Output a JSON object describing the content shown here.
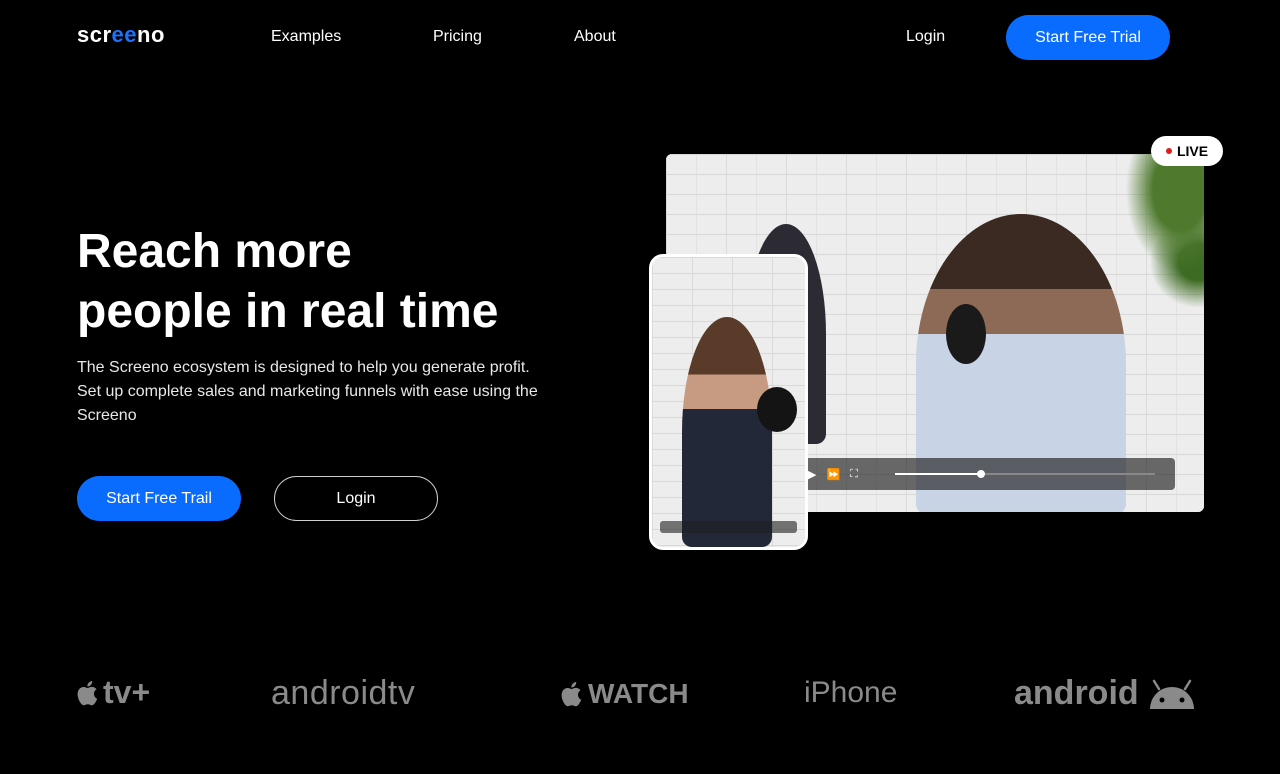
{
  "nav": {
    "logo": "screeno",
    "links": [
      "Examples",
      "Pricing",
      "About"
    ],
    "login": "Login",
    "cta": "Start Free Trial"
  },
  "hero": {
    "title_line1": "Reach more",
    "title_line2": "people in real time",
    "description": "The Screeno ecosystem is designed to help you generate profit. Set up complete sales and marketing funnels with ease using the Screeno",
    "primary_button": "Start Free Trail",
    "secondary_button": "Login"
  },
  "media": {
    "live_badge": "LIVE",
    "video_progress": 0.33
  },
  "platforms": {
    "apple_tv": "tv+",
    "android_tv": "androidtv",
    "watch": "WATCH",
    "iphone": "iPhone",
    "android": "android"
  },
  "colors": {
    "accent": "#0a6cff",
    "background": "#000000",
    "platform_text": "#8a8a8a",
    "live_dot": "#e21b1b"
  }
}
